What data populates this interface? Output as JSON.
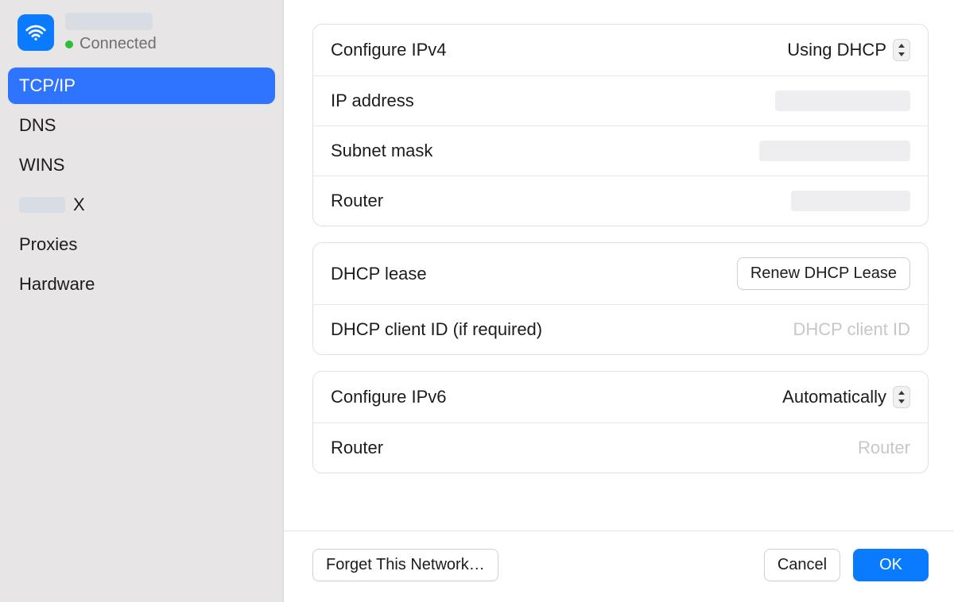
{
  "sidebar": {
    "status_label": "Connected",
    "items": [
      {
        "label": "TCP/IP",
        "selected": true
      },
      {
        "label": "DNS"
      },
      {
        "label": "WINS"
      },
      {
        "label_suffix": "X",
        "redacted_prefix": true
      },
      {
        "label": "Proxies"
      },
      {
        "label": "Hardware"
      }
    ]
  },
  "ipv4": {
    "configure_label": "Configure IPv4",
    "configure_value": "Using DHCP",
    "ip_label": "IP address",
    "subnet_label": "Subnet mask",
    "router_label": "Router"
  },
  "dhcp": {
    "lease_label": "DHCP lease",
    "renew_button": "Renew DHCP Lease",
    "client_id_label": "DHCP client ID (if required)",
    "client_id_placeholder": "DHCP client ID"
  },
  "ipv6": {
    "configure_label": "Configure IPv6",
    "configure_value": "Automatically",
    "router_label": "Router",
    "router_placeholder": "Router"
  },
  "footer": {
    "forget": "Forget This Network…",
    "cancel": "Cancel",
    "ok": "OK"
  }
}
